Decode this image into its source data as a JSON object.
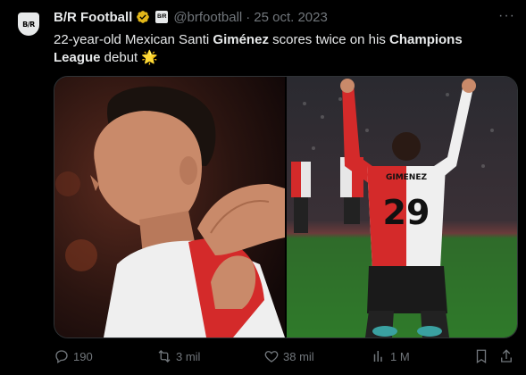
{
  "author": {
    "name": "B/R Football",
    "handle": "@brfootball",
    "separator": "·",
    "date": "25 oct. 2023",
    "avatar_text": "B/R",
    "affiliate_text": "B/R"
  },
  "tweet": {
    "text_part1": "22-year-old Mexican Santi ",
    "text_bold1": "Giménez",
    "text_part2": " scores twice on his ",
    "text_bold2": "Champions League",
    "text_part3": " debut ",
    "emoji": "🌟"
  },
  "media": {
    "right_jersey_name": "GIMENEZ",
    "right_jersey_number": "29"
  },
  "actions": {
    "replies": "190",
    "reposts": "3 mil",
    "likes": "38 mil",
    "views": "1 M"
  },
  "colors": {
    "background": "#000000",
    "text": "#e7e9ea",
    "muted": "#71767b",
    "verified_gold": "#e2b719"
  },
  "icons": [
    "more-icon",
    "verified-badge-icon",
    "reply-icon",
    "repost-icon",
    "like-icon",
    "views-icon",
    "bookmark-icon",
    "share-icon"
  ]
}
